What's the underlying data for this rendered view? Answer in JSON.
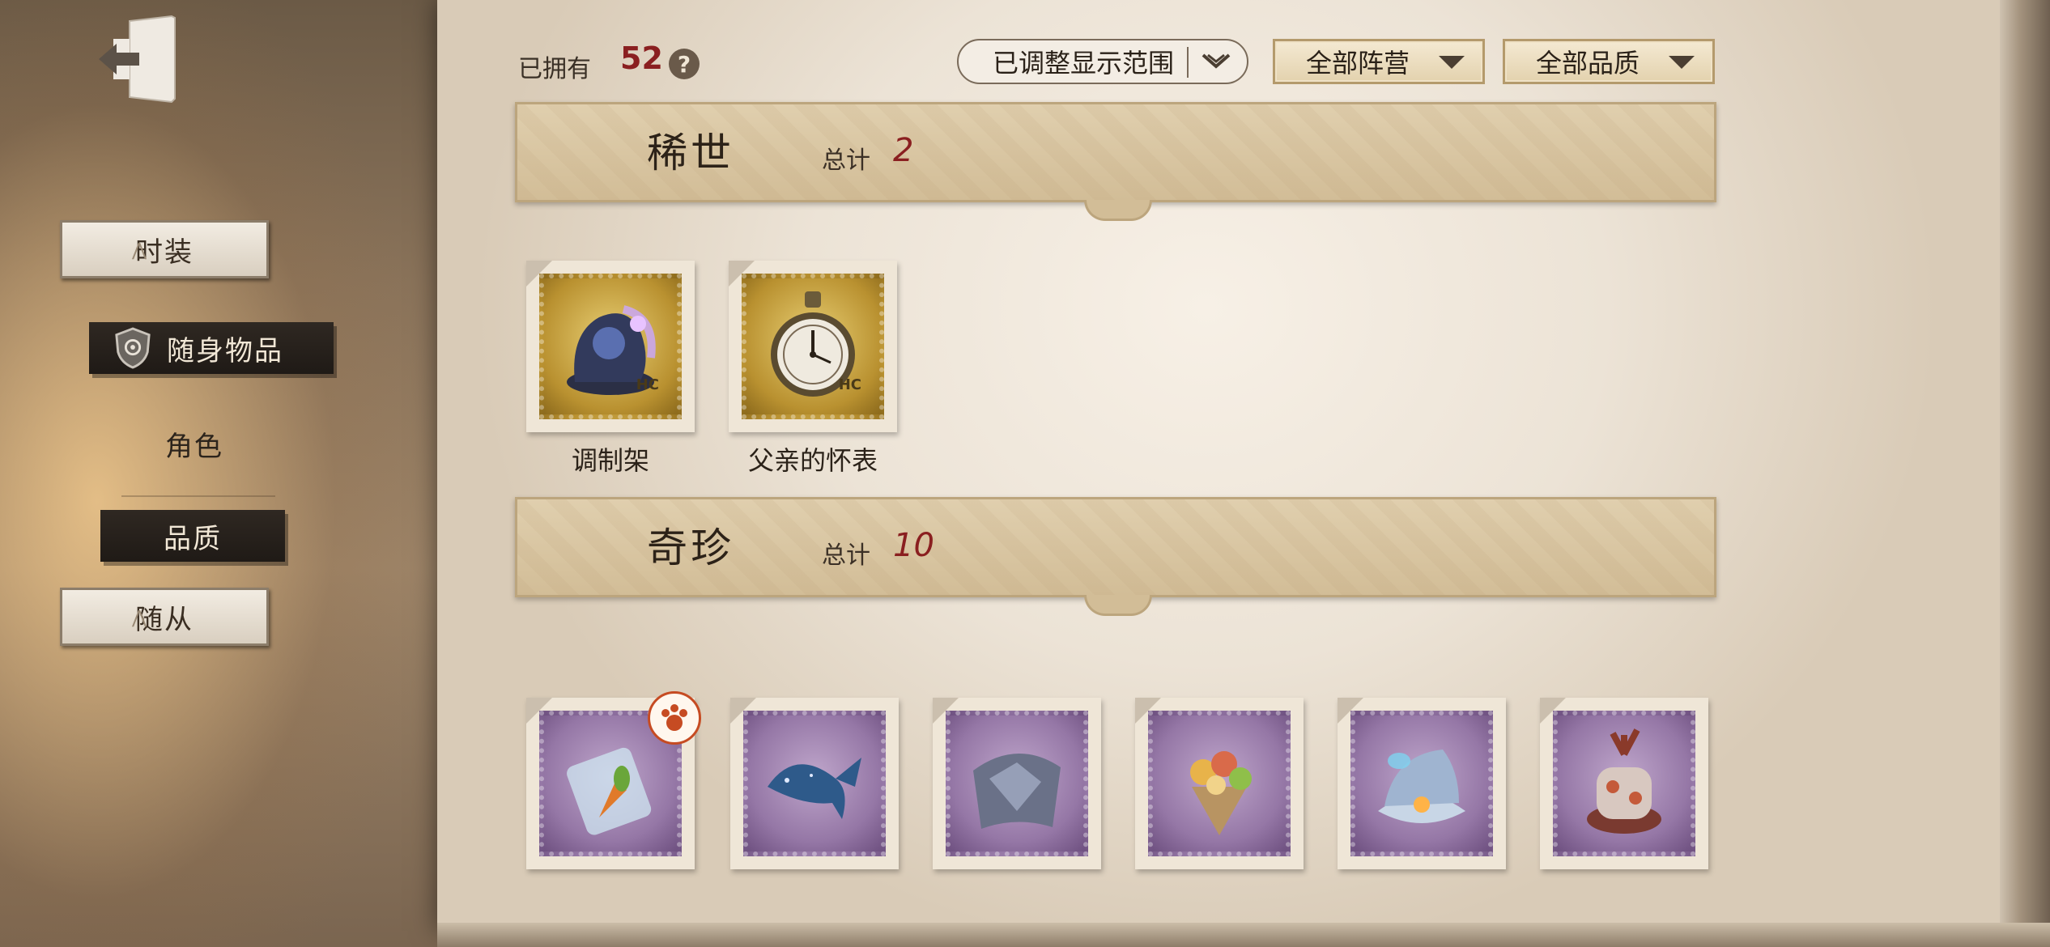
{
  "sidebar": {
    "items": [
      {
        "label": "时装"
      },
      {
        "label": "随身物品"
      },
      {
        "label": "角色"
      },
      {
        "label": "品质"
      },
      {
        "label": "随从"
      }
    ]
  },
  "header": {
    "owned_label": "已拥有",
    "owned_count": "52",
    "help": "?"
  },
  "filters": {
    "range": "已调整显示范围",
    "faction": "全部阵营",
    "quality": "全部品质"
  },
  "sections": [
    {
      "title": "稀世",
      "total_label": "总计",
      "total_value": "2",
      "items": [
        {
          "name": "调制架",
          "icon": "alchemy-rack-icon",
          "frame": "gold"
        },
        {
          "name": "父亲的怀表",
          "icon": "pocket-watch-icon",
          "frame": "gold"
        }
      ]
    },
    {
      "title": "奇珍",
      "total_label": "总计",
      "total_value": "10",
      "items": [
        {
          "icon": "carrot-jar-icon",
          "frame": "purple",
          "badge": "paw-badge-icon"
        },
        {
          "icon": "whale-icon",
          "frame": "purple"
        },
        {
          "icon": "crystal-cloth-icon",
          "frame": "purple"
        },
        {
          "icon": "fruit-bouquet-icon",
          "frame": "purple"
        },
        {
          "icon": "pearl-shell-icon",
          "frame": "purple"
        },
        {
          "icon": "coral-cake-icon",
          "frame": "purple"
        }
      ]
    }
  ],
  "stamp_tag": "HC",
  "colors": {
    "accent_red": "#8a1f20",
    "rare_gold": "#c9a23e",
    "treasure_purple": "#9577a6"
  }
}
